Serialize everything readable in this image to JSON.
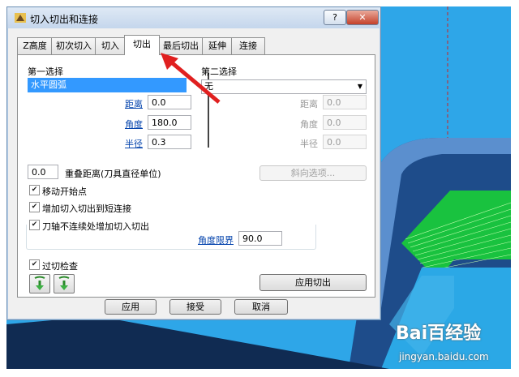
{
  "colors": {
    "accent": "#3399ff",
    "link": "#0645ad",
    "arrow": "#e02020",
    "background_cad": "#2fa7e6"
  },
  "window": {
    "title": "切入切出和连接",
    "help_button": "?",
    "close_button": "✕"
  },
  "tabs": [
    {
      "label": "Z高度",
      "active": false
    },
    {
      "label": "初次切入",
      "active": false
    },
    {
      "label": "切入",
      "active": false
    },
    {
      "label": "切出",
      "active": true
    },
    {
      "label": "最后切出",
      "active": false
    },
    {
      "label": "延伸",
      "active": false
    },
    {
      "label": "连接",
      "active": false
    }
  ],
  "first_choice": {
    "heading": "第一选择",
    "value": "水平圆弧",
    "distance_label": "距离",
    "distance": "0.0",
    "angle_label": "角度",
    "angle": "180.0",
    "radius_label": "半径",
    "radius": "0.3"
  },
  "second_choice": {
    "heading": "第二选择",
    "value": "无",
    "distance_label": "距离",
    "distance": "0.0",
    "angle_label": "角度",
    "angle": "0.0",
    "radius_label": "半径",
    "radius": "0.0"
  },
  "overlap": {
    "value": "0.0",
    "label": "重叠距离(刀具直径单位)"
  },
  "ramp_button": "斜向选项...",
  "checkboxes": {
    "move_start": {
      "label": "移动开始点",
      "checked": true
    },
    "add_short": {
      "label": "增加切入切出到短连接",
      "checked": true
    },
    "tool_axis": {
      "label": "刀轴不连续处增加切入切出",
      "checked": true
    },
    "gouge": {
      "label": "过切检查",
      "checked": true
    }
  },
  "angle_limit": {
    "label": "角度限界",
    "value": "90.0"
  },
  "apply_exit_button": "应用切出",
  "footer": {
    "apply": "应用",
    "accept": "接受",
    "cancel": "取消"
  },
  "watermark": {
    "logo": "Bai百经验",
    "url": "jingyan.baidu.com"
  }
}
